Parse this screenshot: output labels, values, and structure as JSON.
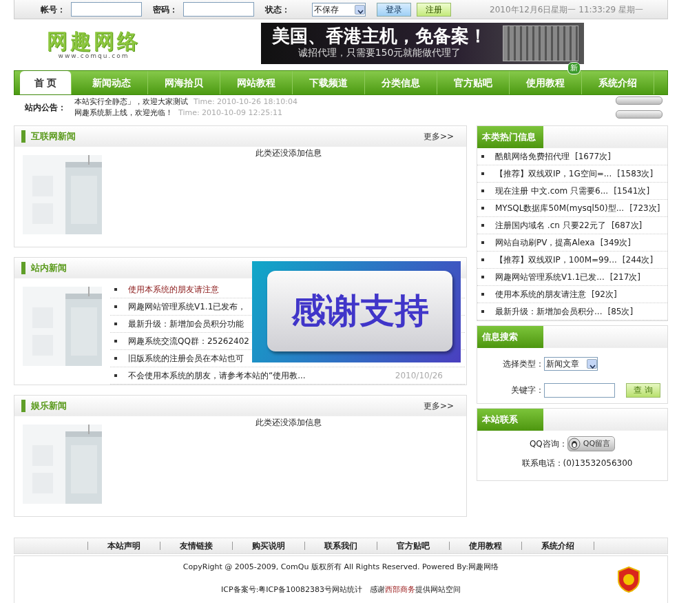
{
  "login_bar": {
    "fields": [
      {
        "label": "帐号："
      },
      {
        "label": "密码："
      }
    ],
    "status": {
      "label": "状态：",
      "value": "不保存"
    },
    "buttons": [
      {
        "label": "登录",
        "kind": "login"
      },
      {
        "label": "注册",
        "kind": "register"
      }
    ],
    "datetime": "2010年12月6日星期一 11:33:29 星期一"
  },
  "logo": {
    "title": "网趣网络",
    "url": "www.comqu.com"
  },
  "banner": {
    "headline": "美国、香港主机，免备案！",
    "subline": "诚招代理，只需要150元就能做代理了"
  },
  "nav": [
    {
      "label": "首 页",
      "selected": true
    },
    {
      "label": "新闻动态",
      "selected": false
    },
    {
      "label": "网海拾贝",
      "selected": false
    },
    {
      "label": "网站教程",
      "selected": false
    },
    {
      "label": "下载频道",
      "selected": false
    },
    {
      "label": "分类信息",
      "selected": false
    },
    {
      "label": "官方贴吧",
      "selected": false
    },
    {
      "label": "使用教程",
      "selected": false,
      "badge": "新"
    },
    {
      "label": "系统介绍",
      "selected": false
    }
  ],
  "announcement": {
    "label": "站内公告：",
    "items": [
      {
        "text": "本站实行全静态」，欢迎大家测试",
        "time": "Time: 2010-10-26 18:10:04"
      },
      {
        "text": "网趣系统新上线，欢迎光临！",
        "time": "Time: 2010-10-09 12:25:11"
      }
    ]
  },
  "news_sections": [
    {
      "title": "互联网新闻",
      "more": "更多>>",
      "empty": "此类还没添加信息"
    },
    {
      "title": "站内新闻",
      "items": [
        {
          "text": "使用本系统的朋友请注意",
          "highlight": true
        },
        {
          "text": "网趣网站管理系统V1.1已发布，",
          "highlight": false
        },
        {
          "text": "最新升级：新增加会员积分功能",
          "highlight": false
        },
        {
          "text": "网趣系统交流QQ群：25262402",
          "highlight": false
        },
        {
          "text": "旧版系统的注册会员在本站也可",
          "highlight": false
        },
        {
          "text": "不会使用本系统的朋友，请参考本站的“使用教...",
          "highlight": false,
          "date": "2010/10/26"
        }
      ]
    },
    {
      "title": "娱乐新闻",
      "more": "更多>>",
      "empty": "此类还没添加信息"
    }
  ],
  "popup_ad": {
    "text": "感谢支持"
  },
  "hot": {
    "title": "本类热门信息",
    "items": [
      {
        "text": "酷航网络免费招代理",
        "count": "[1677次]"
      },
      {
        "text": "【推荐】双线双IP，1G空间=...",
        "count": "[1583次]"
      },
      {
        "text": "现在注册 中文.com 只需要6...",
        "count": "[1541次]"
      },
      {
        "text": "MYSQL数据库50M(mysql50)型...",
        "count": "[723次]"
      },
      {
        "text": "注册国内域名 .cn 只要22元了",
        "count": "[687次]"
      },
      {
        "text": "网站自动刷PV，提高Alexa",
        "count": "[349次]"
      },
      {
        "text": "【推荐】双线双IP，100M=99...",
        "count": "[244次]"
      },
      {
        "text": "网趣网站管理系统V1.1已发...",
        "count": "[217次]"
      },
      {
        "text": "使用本系统的朋友请注意",
        "count": "[92次]"
      },
      {
        "text": "最新升级：新增加会员积分...",
        "count": "[85次]"
      }
    ]
  },
  "search": {
    "title": "信息搜索",
    "type_label": "选择类型：",
    "type_value": "新闻文章",
    "keyword_label": "关键字：",
    "button": "查 询"
  },
  "contact": {
    "title": "本站联系",
    "qq_label": "QQ咨询：",
    "qq_button": "QQ留言",
    "phone_label": "联系电话：",
    "phone": "(0)13532056300"
  },
  "footer": {
    "links": [
      "本站声明",
      "友情链接",
      "购买说明",
      "联系我们",
      "官方贴吧",
      "使用教程",
      "系统介绍"
    ],
    "copyright": "CopyRight @ 2005-2009, ComQu 版权所有 All Rights Reserved. Powered By:网趣网络",
    "icp": "ICP备案号:粤ICP备10082383号网站统计",
    "thanks_before": "感谢",
    "sponsor": "西部商务",
    "thanks_after": "提供网站空间"
  }
}
